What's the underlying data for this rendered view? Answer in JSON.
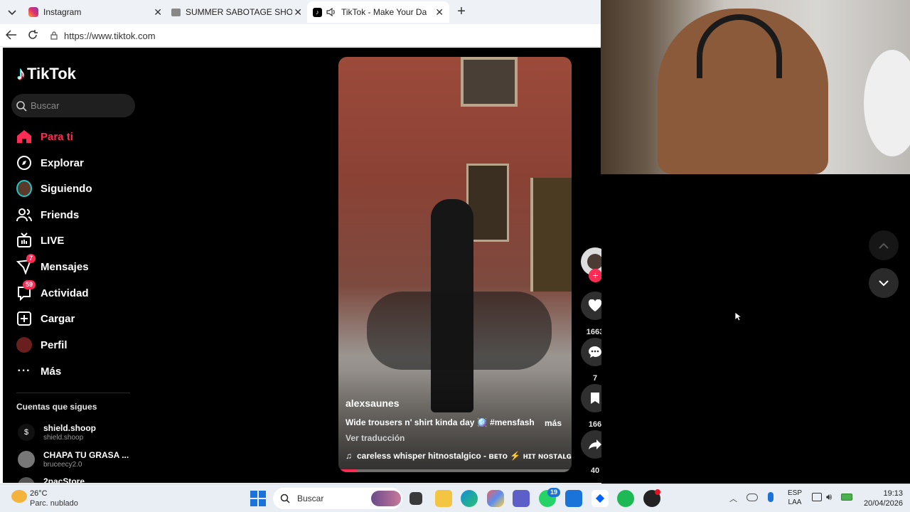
{
  "tabs": [
    {
      "title": "Instagram"
    },
    {
      "title": "SUMMER SABOTAGE SHORTS | Per"
    },
    {
      "title": "TikTok - Make Your Day"
    }
  ],
  "address": {
    "url": "https://www.tiktok.com"
  },
  "tiktok": {
    "logo": "TikTok",
    "search_placeholder": "Buscar",
    "nav": [
      {
        "label": "Para ti",
        "icon": "home-icon"
      },
      {
        "label": "Explorar",
        "icon": "compass-icon"
      },
      {
        "label": "Siguiendo",
        "icon": "following-avatar-icon"
      },
      {
        "label": "Friends",
        "icon": "friends-icon"
      },
      {
        "label": "LIVE",
        "icon": "live-tv-icon"
      },
      {
        "label": "Mensajes",
        "icon": "messages-icon",
        "badge": "7"
      },
      {
        "label": "Actividad",
        "icon": "activity-icon",
        "badge": "59"
      },
      {
        "label": "Cargar",
        "icon": "upload-icon"
      },
      {
        "label": "Perfil",
        "icon": "profile-avatar-icon"
      },
      {
        "label": "Más",
        "icon": "more-icon"
      }
    ],
    "following_header": "Cuentas que sigues",
    "following": [
      {
        "name": "shield.shoop",
        "handle": "shield.shoop"
      },
      {
        "name": "CHAPA TU GRASA ...",
        "handle": "bruceecy2.0"
      },
      {
        "name": "2pacStore",
        "handle": ""
      }
    ],
    "video": {
      "username": "alexsaunes",
      "caption": "Wide trousers n' shirt kinda day 🪩 #mensfashio...",
      "more": "más",
      "translate": "Ver traducción",
      "music": "careless whisper hitnostalgico - ʙᴇᴛᴏ ⚡ ʜɪᴛ ɴᴏsᴛᴀʟɢɪᴄᴏ",
      "progress": 0.08
    },
    "actions": {
      "likes": "1663",
      "comments": "7",
      "saves": "166",
      "shares": "40"
    }
  },
  "taskbar": {
    "weather_temp": "26°C",
    "weather_desc": "Parc. nublado",
    "search": "Buscar",
    "whatsapp_badge": "19",
    "lang_top": "ESP",
    "lang_bottom": "LAA",
    "time": "19:13",
    "date": "20/04/2026"
  }
}
